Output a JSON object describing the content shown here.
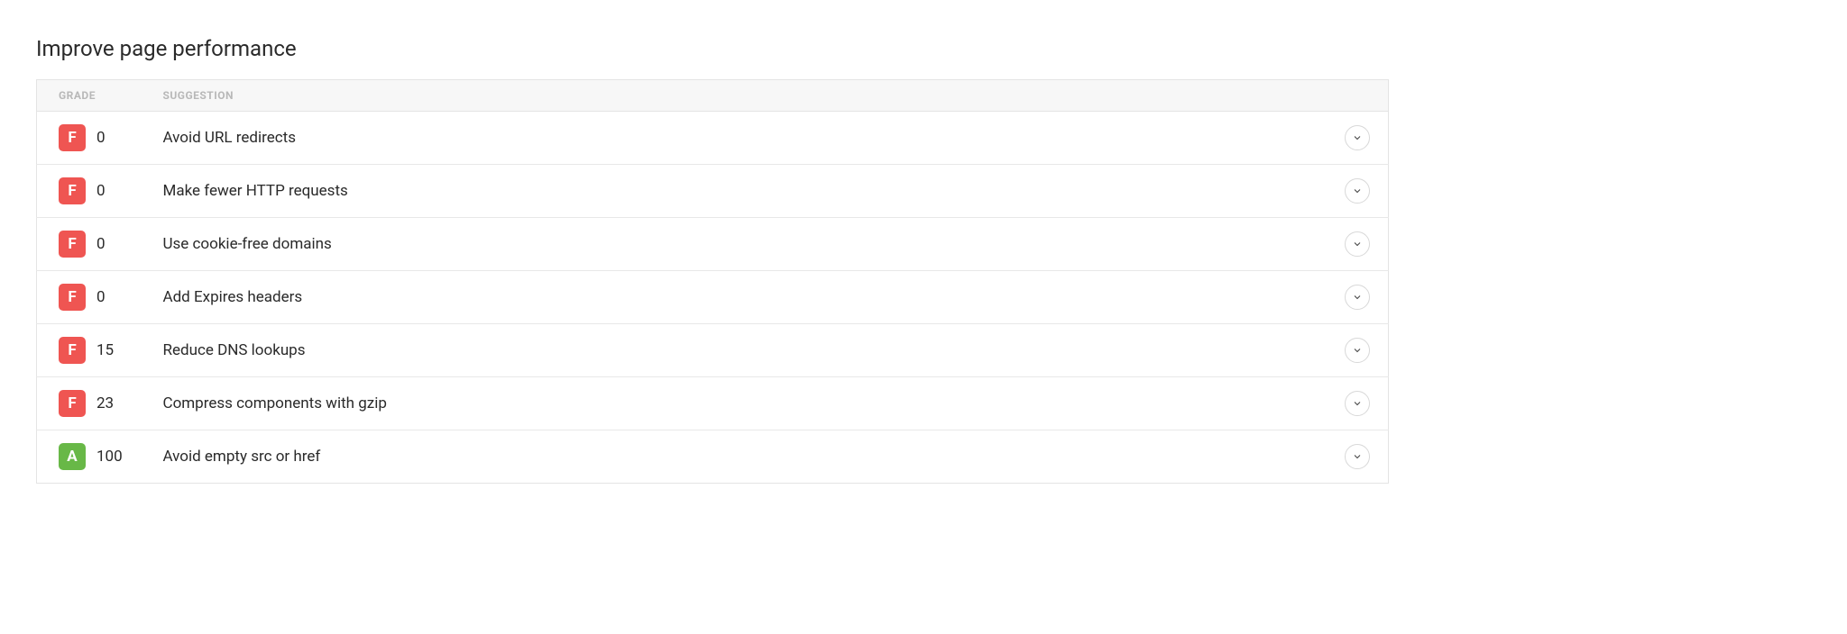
{
  "title": "Improve page performance",
  "columns": {
    "grade": "GRADE",
    "suggestion": "SUGGESTION"
  },
  "rows": [
    {
      "gradeLetter": "F",
      "gradeClass": "grade-f",
      "score": "0",
      "suggestion": "Avoid URL redirects"
    },
    {
      "gradeLetter": "F",
      "gradeClass": "grade-f",
      "score": "0",
      "suggestion": "Make fewer HTTP requests"
    },
    {
      "gradeLetter": "F",
      "gradeClass": "grade-f",
      "score": "0",
      "suggestion": "Use cookie-free domains"
    },
    {
      "gradeLetter": "F",
      "gradeClass": "grade-f",
      "score": "0",
      "suggestion": "Add Expires headers"
    },
    {
      "gradeLetter": "F",
      "gradeClass": "grade-f",
      "score": "15",
      "suggestion": "Reduce DNS lookups"
    },
    {
      "gradeLetter": "F",
      "gradeClass": "grade-f",
      "score": "23",
      "suggestion": "Compress components with gzip"
    },
    {
      "gradeLetter": "A",
      "gradeClass": "grade-a",
      "score": "100",
      "suggestion": "Avoid empty src or href"
    }
  ]
}
